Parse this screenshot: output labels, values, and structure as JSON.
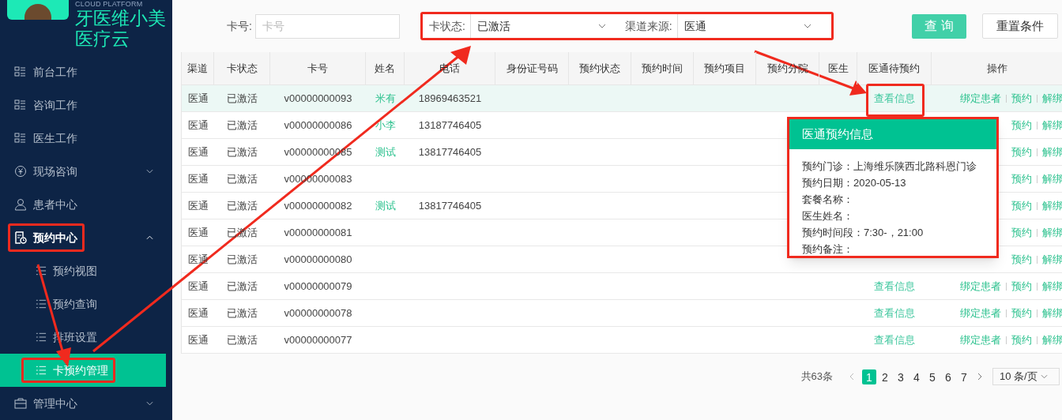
{
  "logo": {
    "subtitle": "CLOUD PLATFORM",
    "title_line_1": "牙医维小美",
    "title_line_2": "医疗云"
  },
  "sidebar": {
    "items": [
      {
        "label": "前台工作",
        "selected": false
      },
      {
        "label": "咨询工作",
        "selected": false
      },
      {
        "label": "医生工作",
        "selected": false
      },
      {
        "label": "现场咨询",
        "selected": false,
        "expanded": false
      },
      {
        "label": "患者中心",
        "selected": false
      },
      {
        "label": "预约中心",
        "selected": false,
        "expanded": true,
        "highlighted": true,
        "children": [
          {
            "label": "预约视图",
            "selected": false
          },
          {
            "label": "预约查询",
            "selected": false
          },
          {
            "label": "排班设置",
            "selected": false
          },
          {
            "label": "卡预约管理",
            "selected": true,
            "highlighted": true
          }
        ]
      },
      {
        "label": "管理中心",
        "selected": false,
        "expanded": false
      }
    ]
  },
  "filters": {
    "card_no": {
      "label": "卡号:",
      "placeholder": "卡号"
    },
    "highlighted": true,
    "card_status": {
      "label": "卡状态:",
      "value": "已激活"
    },
    "channel_source": {
      "label": "渠道来源:",
      "value": "医通"
    },
    "buttons": [
      "查 询",
      "重置条件"
    ]
  },
  "table": {
    "columns": [
      "渠道",
      "卡状态",
      "卡号",
      "姓名",
      "电话",
      "身份证号码",
      "预约状态",
      "预约时间",
      "预约项目",
      "预约分院",
      "医生",
      "医通待预约",
      "操作"
    ],
    "rows": [
      {
        "channel": "医通",
        "card_status": "已激活",
        "card_no": "v00000000093",
        "name": "米有",
        "phone": "18969463521",
        "selected": true,
        "pending": {
          "text": "查看信息",
          "highlighted": true
        },
        "actions": [
          "绑定患者",
          "预约",
          "解绑"
        ]
      },
      {
        "channel": "医通",
        "card_status": "已激活",
        "card_no": "v00000000086",
        "name": "小李",
        "phone": "13187746405",
        "selected": false,
        "actions": [
          "预约",
          "解绑"
        ]
      },
      {
        "channel": "医通",
        "card_status": "已激活",
        "card_no": "v00000000085",
        "name": "测试",
        "phone": "13817746405",
        "selected": false,
        "actions": [
          "预约",
          "解绑"
        ]
      },
      {
        "channel": "医通",
        "card_status": "已激活",
        "card_no": "v00000000083",
        "selected": false,
        "actions": [
          "预约",
          "解绑"
        ]
      },
      {
        "channel": "医通",
        "card_status": "已激活",
        "card_no": "v00000000082",
        "name": "测试",
        "phone": "13817746405",
        "selected": false,
        "actions": [
          "预约",
          "解绑"
        ]
      },
      {
        "channel": "医通",
        "card_status": "已激活",
        "card_no": "v00000000081",
        "selected": false,
        "actions": [
          "预约",
          "解绑"
        ]
      },
      {
        "channel": "医通",
        "card_status": "已激活",
        "card_no": "v00000000080",
        "selected": false,
        "actions": [
          "预约",
          "解绑"
        ]
      },
      {
        "channel": "医通",
        "card_status": "已激活",
        "card_no": "v00000000079",
        "selected": false,
        "pending": {
          "text": "查看信息"
        },
        "actions": [
          "绑定患者",
          "预约",
          "解绑"
        ]
      },
      {
        "channel": "医通",
        "card_status": "已激活",
        "card_no": "v00000000078",
        "selected": false,
        "pending": {
          "text": "查看信息"
        },
        "actions": [
          "绑定患者",
          "预约",
          "解绑"
        ]
      },
      {
        "channel": "医通",
        "card_status": "已激活",
        "card_no": "v00000000077",
        "selected": false,
        "pending": {
          "text": "查看信息"
        },
        "actions": [
          "绑定患者",
          "预约",
          "解绑"
        ]
      }
    ]
  },
  "popover": {
    "title": "医通预约信息",
    "highlighted": true,
    "lines": [
      "预约门诊：上海维乐陕西北路科恩门诊",
      "预约日期：2020-05-13",
      "套餐名称：",
      "医生姓名：",
      "预约时间段：7:30-，21:00",
      "预约备注："
    ]
  },
  "pagination": {
    "total": "共63条",
    "pages": [
      {
        "label": "1",
        "selected": true
      },
      {
        "label": "2",
        "selected": false
      },
      {
        "label": "3",
        "selected": false
      },
      {
        "label": "4",
        "selected": false
      },
      {
        "label": "5",
        "selected": false
      },
      {
        "label": "6",
        "selected": false
      },
      {
        "label": "7",
        "selected": false
      }
    ],
    "page_size": "10 条/页"
  }
}
